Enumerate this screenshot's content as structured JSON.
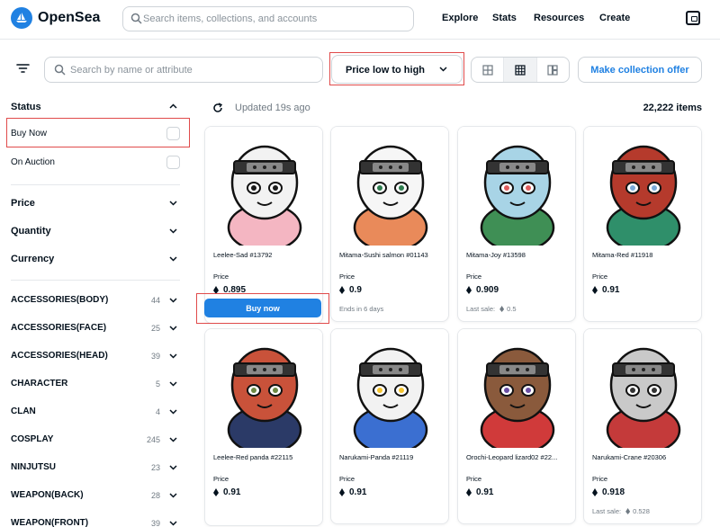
{
  "brand": {
    "name": "OpenSea",
    "logo_icon": "sailboat-icon",
    "color": "#2081e2"
  },
  "header_search": {
    "placeholder": "Search items, collections, and accounts"
  },
  "nav": {
    "explore": "Explore",
    "stats": "Stats",
    "resources": "Resources",
    "create": "Create",
    "wallet_icon": "wallet-icon"
  },
  "toolbar": {
    "filter_icon": "filter-icon",
    "search_placeholder": "Search by name or attribute",
    "sort_label": "Price low to high",
    "view_icons": [
      "large-grid-icon",
      "small-grid-icon",
      "mixed-grid-icon"
    ],
    "make_offer": "Make collection offer"
  },
  "sidebar": {
    "status": {
      "title": "Status",
      "options": [
        "Buy Now",
        "On Auction"
      ]
    },
    "price": "Price",
    "quantity": "Quantity",
    "currency": "Currency",
    "traits": [
      {
        "name": "ACCESSORIES(BODY)",
        "count": "44"
      },
      {
        "name": "ACCESSORIES(FACE)",
        "count": "25"
      },
      {
        "name": "ACCESSORIES(HEAD)",
        "count": "39"
      },
      {
        "name": "CHARACTER",
        "count": "5"
      },
      {
        "name": "CLAN",
        "count": "4"
      },
      {
        "name": "COSPLAY",
        "count": "245"
      },
      {
        "name": "NINJUTSU",
        "count": "23"
      },
      {
        "name": "WEAPON(BACK)",
        "count": "28"
      },
      {
        "name": "WEAPON(FRONT)",
        "count": "39"
      }
    ]
  },
  "results": {
    "updated": "Updated 19s ago",
    "count": "22,222 items"
  },
  "price_label": "Price",
  "buy_now_label": "Buy now",
  "items": [
    {
      "name": "Leelee-Sad #13792",
      "price": "0.895",
      "extra": ""
    },
    {
      "name": "Mitama-Sushi salmon #01143",
      "price": "0.9",
      "extra": "Ends in 6 days"
    },
    {
      "name": "Mitama-Joy #13598",
      "price": "0.909",
      "extra": "Last sale:",
      "extra_price": "0.5"
    },
    {
      "name": "Mitama-Red #11918",
      "price": "0.91",
      "extra": ""
    },
    {
      "name": "Leelee-Red panda #22115",
      "price": "0.91",
      "extra": ""
    },
    {
      "name": "Narukami-Panda #21119",
      "price": "0.91",
      "extra": ""
    },
    {
      "name": "Orochi-Leopard lizard02 #22...",
      "price": "0.91",
      "extra": ""
    },
    {
      "name": "Narukami-Crane #20306",
      "price": "0.918",
      "extra": "Last sale:",
      "extra_price": "0.528"
    }
  ]
}
